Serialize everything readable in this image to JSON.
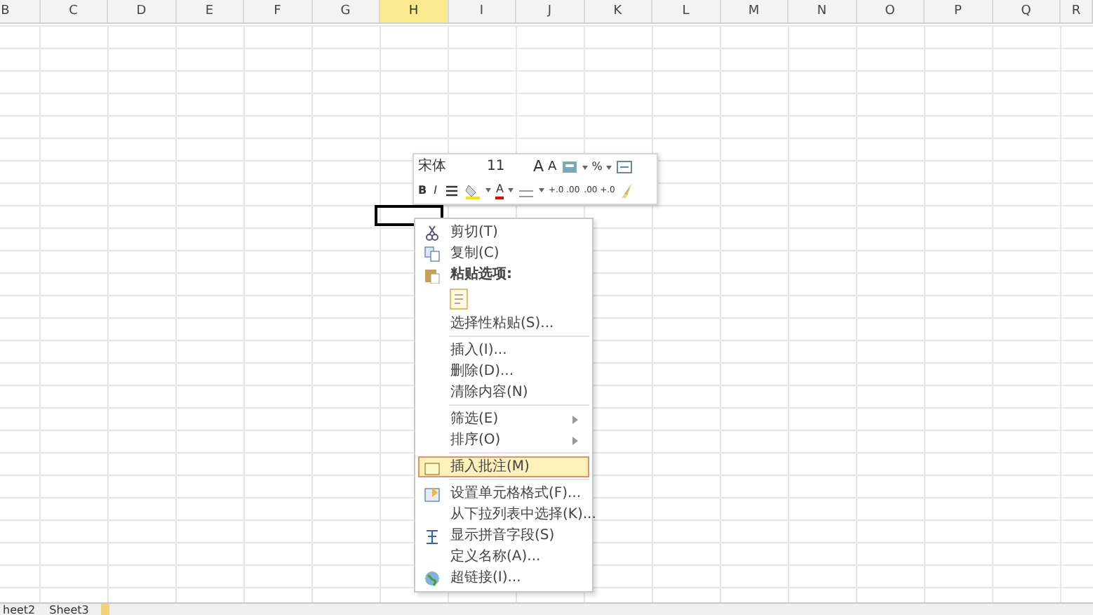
{
  "columns": [
    {
      "label": "B",
      "selected": false
    },
    {
      "label": "C",
      "selected": false
    },
    {
      "label": "D",
      "selected": false
    },
    {
      "label": "E",
      "selected": false
    },
    {
      "label": "F",
      "selected": false
    },
    {
      "label": "G",
      "selected": false
    },
    {
      "label": "H",
      "selected": true
    },
    {
      "label": "I",
      "selected": false
    },
    {
      "label": "J",
      "selected": false
    },
    {
      "label": "K",
      "selected": false
    },
    {
      "label": "L",
      "selected": false
    },
    {
      "label": "M",
      "selected": false
    },
    {
      "label": "N",
      "selected": false
    },
    {
      "label": "O",
      "selected": false
    },
    {
      "label": "P",
      "selected": false
    },
    {
      "label": "Q",
      "selected": false
    },
    {
      "label": "R",
      "selected": false
    }
  ],
  "mini_toolbar": {
    "upper_row": [
      {
        "kind": "font",
        "text": "宋体"
      },
      {
        "kind": "size",
        "text": "11"
      },
      {
        "kind": "grow",
        "text": "A"
      },
      {
        "kind": "shrink",
        "text": "A"
      },
      {
        "kind": "format-icon"
      },
      {
        "kind": "caret"
      },
      {
        "kind": "text",
        "text": "%"
      },
      {
        "kind": "caret"
      },
      {
        "kind": "merge-icon"
      }
    ],
    "lower_row": [
      {
        "kind": "bold",
        "text": "B"
      },
      {
        "kind": "italic",
        "text": "I"
      },
      {
        "kind": "align-icon"
      },
      {
        "kind": "fill-icon"
      },
      {
        "kind": "caret"
      },
      {
        "kind": "fontcolor",
        "text": "A"
      },
      {
        "kind": "caret"
      },
      {
        "kind": "border-icon"
      },
      {
        "kind": "caret"
      },
      {
        "kind": "small",
        "text": "+.0 .00"
      },
      {
        "kind": "small",
        "text": ".00 +.0"
      },
      {
        "kind": "brush-icon"
      }
    ]
  },
  "context_menu": [
    {
      "kind": "cut",
      "label": "剪切(T)",
      "selected": false
    },
    {
      "kind": "copy",
      "label": "复制(C)",
      "selected": false
    },
    {
      "kind": "heading",
      "label": "粘贴选项:"
    },
    {
      "kind": "paste-options"
    },
    {
      "kind": "item",
      "label": "选择性粘贴(S)...",
      "selected": false
    },
    {
      "kind": "separator"
    },
    {
      "kind": "item",
      "label": "插入(I)...",
      "selected": false
    },
    {
      "kind": "item",
      "label": "删除(D)...",
      "selected": false
    },
    {
      "kind": "item",
      "label": "清除内容(N)",
      "selected": false
    },
    {
      "kind": "separator"
    },
    {
      "kind": "submenu",
      "label": "筛选(E)",
      "selected": false
    },
    {
      "kind": "submenu",
      "label": "排序(O)",
      "selected": false
    },
    {
      "kind": "separator"
    },
    {
      "kind": "comment",
      "label": "插入批注(M)",
      "selected": true
    },
    {
      "kind": "separator"
    },
    {
      "kind": "format",
      "label": "设置单元格格式(F)...",
      "selected": false
    },
    {
      "kind": "item",
      "label": "从下拉列表中选择(K)...",
      "selected": false
    },
    {
      "kind": "phonetic",
      "label": "显示拼音字段(S)",
      "selected": false
    },
    {
      "kind": "item",
      "label": "定义名称(A)...",
      "selected": false
    },
    {
      "kind": "link",
      "label": "超链接(I)...",
      "selected": false
    }
  ],
  "sheet_tabs": [
    {
      "label": "heet2",
      "selected": false
    },
    {
      "label": "Sheet3",
      "selected": false
    }
  ]
}
